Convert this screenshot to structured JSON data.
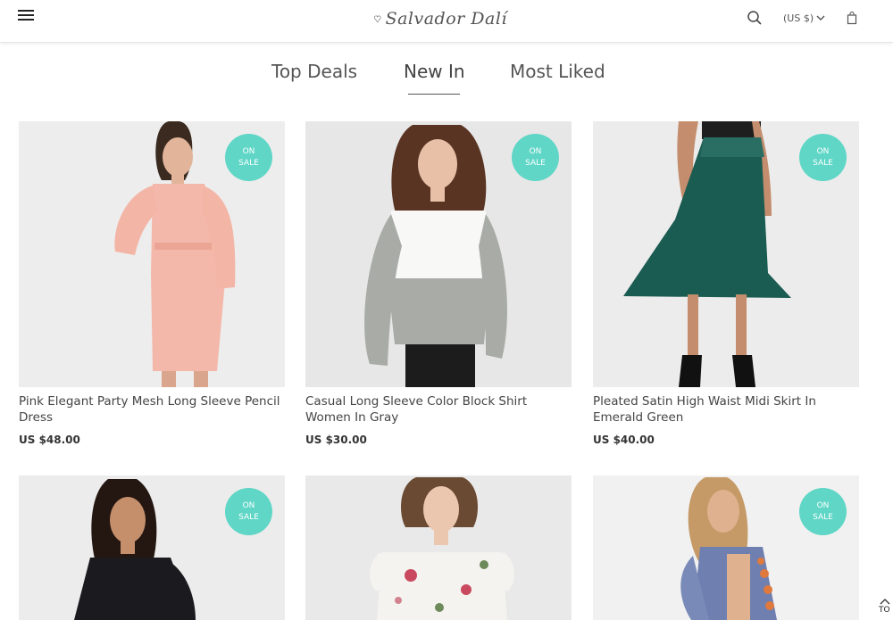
{
  "header": {
    "logo_text": "Salvador Dalí",
    "currency_label": "(US $)",
    "icons": [
      "menu-icon",
      "logo-mark-icon",
      "search-icon",
      "chevron-down-icon",
      "shopping-bag-icon"
    ]
  },
  "tabs": [
    {
      "label": "Top Deals",
      "active": false
    },
    {
      "label": "New In",
      "active": true
    },
    {
      "label": "Most Liked",
      "active": false
    }
  ],
  "badge": {
    "line1": "ON",
    "line2": "SALE",
    "color": "#5fd6c6"
  },
  "products": [
    {
      "title": "Pink Elegant Party Mesh Long Sleeve Pencil Dress",
      "price": "US $48.00"
    },
    {
      "title": "Casual Long Sleeve Color Block Shirt Women In Gray",
      "price": "US $30.00"
    },
    {
      "title": "Pleated Satin High Waist Midi Skirt In Emerald Green",
      "price": "US $40.00"
    },
    {
      "title": "",
      "price": ""
    },
    {
      "title": "",
      "price": ""
    },
    {
      "title": "",
      "price": ""
    }
  ],
  "to_top_label": "TO"
}
